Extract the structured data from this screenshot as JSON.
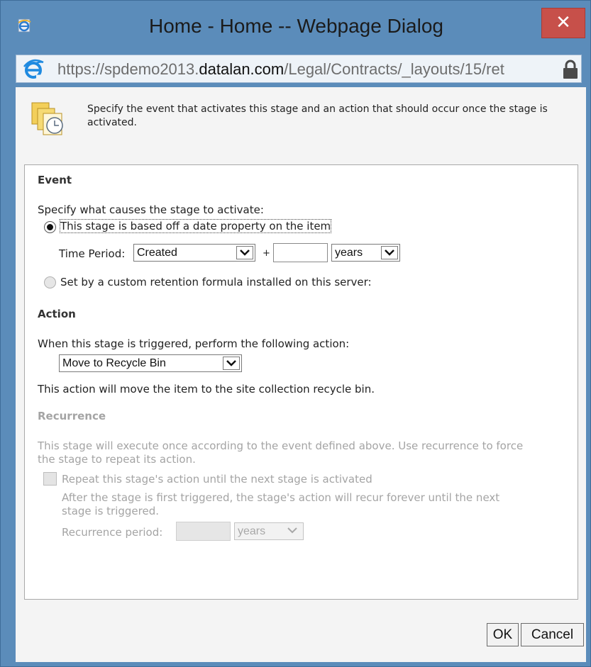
{
  "window": {
    "title": "Home - Home -- Webpage Dialog",
    "close_glyph": "✕",
    "close_color": "#c7504a"
  },
  "address": {
    "scheme": "https://",
    "sub": "spdemo2013.",
    "host": "datalan.com",
    "path": "/Legal/Contracts/_layouts/15/ret"
  },
  "intro": {
    "text": "Specify the event that activates this stage and an action that should occur once the stage is activated.",
    "icon": "stage-clock-icon"
  },
  "event": {
    "heading": "Event",
    "prompt": "Specify what causes the stage to activate:",
    "option_date": "This stage is based off a date property on the item",
    "option_date_selected": true,
    "time_period_label": "Time Period:",
    "time_period_value": "Created",
    "plus": "+",
    "amount_value": "",
    "unit_value": "years",
    "option_formula": "Set by a custom retention formula installed on this server:",
    "option_formula_selected": false
  },
  "action": {
    "heading": "Action",
    "prompt": "When this stage is triggered, perform the following action:",
    "selected": "Move to Recycle Bin",
    "description": "This action will move the item to the site collection recycle bin."
  },
  "recurrence": {
    "heading": "Recurrence",
    "description_line1": "This stage will execute once according to the event defined above. Use recurrence to force",
    "description_line2": "the stage to repeat its action.",
    "checkbox_label": "Repeat this stage's action until the next stage is activated",
    "checked": false,
    "detail_line1": "After the stage is first triggered, the stage's action will recur forever until the next",
    "detail_line2": "stage is triggered.",
    "period_label": "Recurrence period:",
    "period_value": "",
    "period_unit": "years"
  },
  "buttons": {
    "ok": "OK",
    "cancel": "Cancel"
  }
}
